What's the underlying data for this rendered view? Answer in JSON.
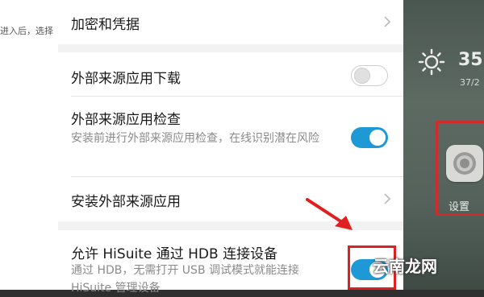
{
  "backdrop_left": {
    "snippet": "进入后，选择"
  },
  "home_screen": {
    "temperature": "35",
    "temp_sub": "37/2",
    "settings_app_label": "设置"
  },
  "watermark": "云南龙网",
  "settings": {
    "items": [
      {
        "title": "加密和凭据",
        "type": "nav"
      },
      {
        "title": "外部来源应用下载",
        "type": "toggle",
        "state": "off"
      },
      {
        "title": "外部来源应用检查",
        "description": "安装前进行外部来源应用检查，在线识别潜在风险",
        "type": "toggle",
        "state": "on"
      },
      {
        "title": "安装外部来源应用",
        "type": "nav"
      },
      {
        "title": "允许 HiSuite 通过 HDB 连接设备",
        "description": "通过 HDB，无需打开 USB 调试模式就能连接 HiSuite 管理设备",
        "type": "toggle",
        "state": "on"
      }
    ]
  },
  "colors": {
    "accent": "#1f99d6",
    "annotation_red": "#e02020"
  }
}
